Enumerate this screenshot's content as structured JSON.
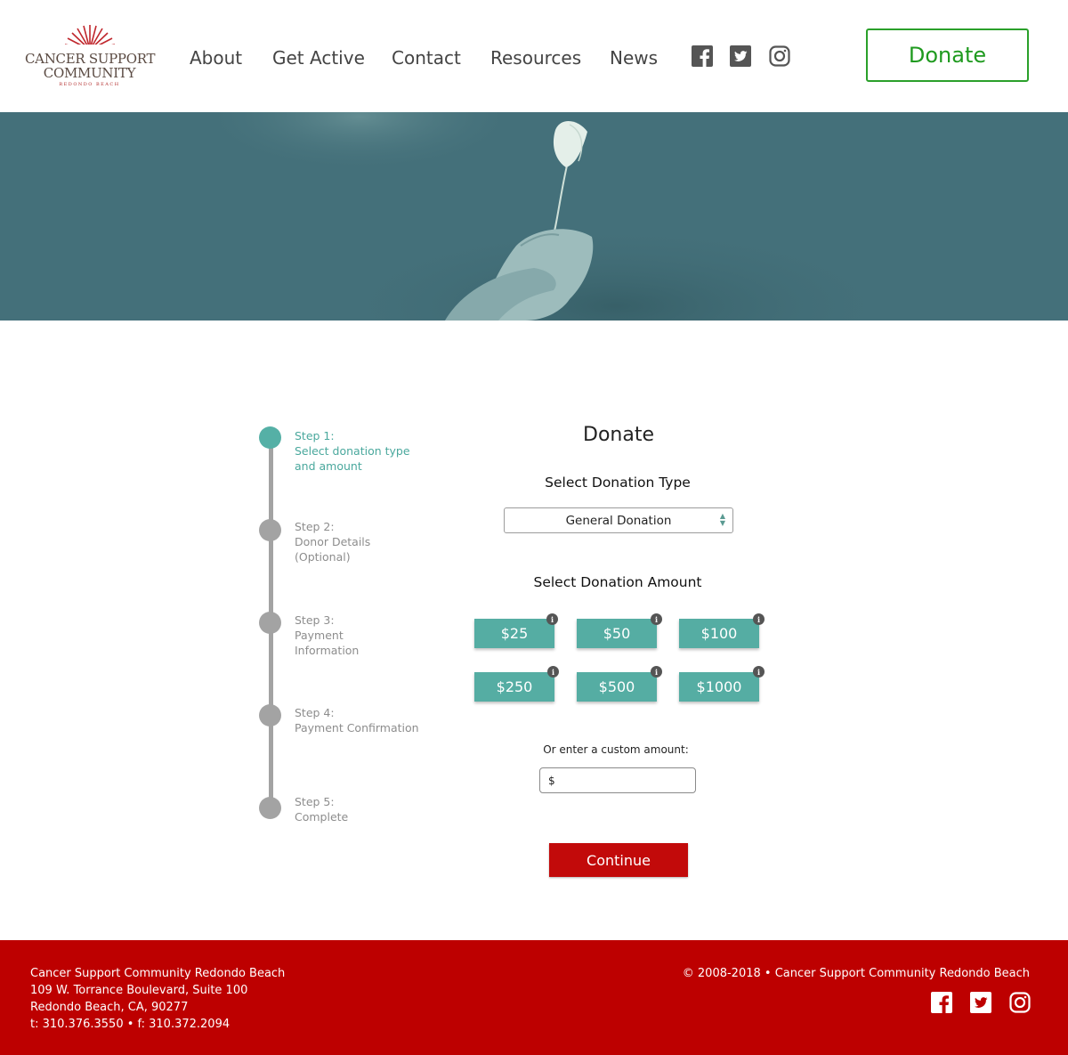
{
  "header": {
    "logo": {
      "line1": "CANCER SUPPORT",
      "line2": "COMMUNITY",
      "line3": "REDONDO BEACH"
    },
    "nav": [
      {
        "label": "About"
      },
      {
        "label": "Get Active"
      },
      {
        "label": "Contact"
      },
      {
        "label": "Resources"
      },
      {
        "label": "News"
      }
    ],
    "social_icons": [
      "facebook-icon",
      "twitter-icon",
      "instagram-icon"
    ],
    "donate_label": "Donate"
  },
  "hero": {
    "description_icon": "hand-holding-flower-image"
  },
  "steps": [
    {
      "title": "Step 1:",
      "desc": "Select donation type and amount",
      "active": true
    },
    {
      "title": "Step 2:",
      "desc": "Donor Details (Optional)",
      "active": false
    },
    {
      "title": "Step 3:",
      "desc": "Payment Information",
      "active": false
    },
    {
      "title": "Step 4:",
      "desc": "Payment Confirmation",
      "active": false
    },
    {
      "title": "Step 5:",
      "desc": "Complete",
      "active": false
    }
  ],
  "form": {
    "title": "Donate",
    "type_label": "Select Donation Type",
    "type_selected": "General Donation",
    "amount_label": "Select Donation Amount",
    "amounts": [
      "$25",
      "$50",
      "$100",
      "$250",
      "$500",
      "$1000"
    ],
    "info_glyph": "i",
    "custom_label": "Or enter a custom amount:",
    "custom_value": "$",
    "continue_label": "Continue"
  },
  "footer": {
    "org": "Cancer Support Community Redondo Beach",
    "address1": "109 W. Torrance Boulevard, Suite 100",
    "address2": "Redondo Beach, CA, 90277",
    "phone": "t: 310.376.3550 • f: 310.372.2094",
    "copyright": "© 2008-2018 • Cancer Support Community Redondo Beach"
  },
  "colors": {
    "brand_red": "#bd0000",
    "teal": "#55ada3",
    "donate_green": "#1f9a1f",
    "hero_teal": "#44707a"
  }
}
